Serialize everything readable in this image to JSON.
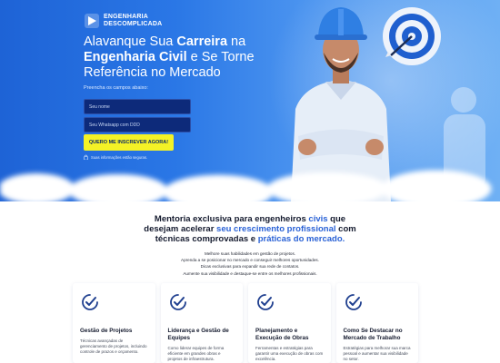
{
  "brand": {
    "line1": "ENGENHARIA",
    "line2": "DESCOMPLICADA"
  },
  "hero": {
    "headline_1": "Alavanque Sua ",
    "headline_bold_1": "Carreira",
    "headline_2": " na ",
    "headline_bold_2": "Engenharia Civil",
    "headline_3": " e Se Torne Referência no Mercado",
    "form_caption": "Preencha os campos abaixo:",
    "name_placeholder": "Seu nome",
    "phone_placeholder": "Seu Whatsapp com DDD",
    "cta_label": "QUERO ME INSCREVER AGORA!",
    "secure_note": "Suas informações estão seguras."
  },
  "mentoria": {
    "title_1": "Mentoria exclusiva para engenheiros ",
    "title_hl_1": "civis",
    "title_2": " que desejam acelerar ",
    "title_hl_2": "seu crescimento profissional",
    "title_3": " com técnicas comprovadas e ",
    "title_hl_3": "práticas do mercado.",
    "benefits": [
      "Melhore suas habilidades em gestão de projetos.",
      "Aprenda a se posicionar no mercado e conseguir melhores oportunidades.",
      "Dicas exclusivas para expandir sua rede de contatos.",
      "Aumente sua visibilidade e destaque-se entre os melhores profissionais."
    ]
  },
  "cards": [
    {
      "title": "Gestão de Projetos",
      "text": "Técnicas avançadas de gerenciamento de projetos, incluindo controle de prazos e orçamento."
    },
    {
      "title": "Liderança e Gestão de Equipes",
      "text": "Como liderar equipes de forma eficiente em grandes obras e projetos de infraestrutura."
    },
    {
      "title": "Planejamento e Execução de Obras",
      "text": "Ferramentas e estratégias para garantir uma execução de obras com excelência."
    },
    {
      "title": "Como Se Destacar no Mercado de Trabalho",
      "text": "Estratégias para melhorar sua marca pessoal e aumentar sua visibilidade no setor."
    }
  ],
  "colors": {
    "accent": "#2a62d6",
    "cta": "#f4f226",
    "field": "#0d2a7a"
  },
  "icons": [
    "logo-mark-icon",
    "lock-icon",
    "check-badge-icon",
    "target-icon"
  ]
}
